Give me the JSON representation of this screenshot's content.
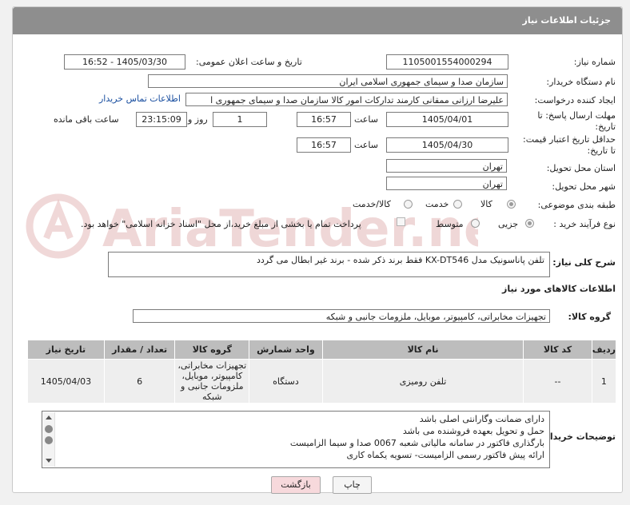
{
  "header": {
    "title": "جزئیات اطلاعات نیاز"
  },
  "fields": {
    "need_number_label": "شماره نیاز:",
    "need_number": "1105001554000294",
    "announce_label": "تاریخ و ساعت اعلان عمومی:",
    "announce_value": "1405/03/30 - 16:52",
    "buyer_label": "نام دستگاه خریدار:",
    "buyer_value": "سازمان صدا و سیمای جمهوری اسلامی ایران",
    "creator_label": "ایجاد کننده درخواست:",
    "creator_value": "علیرضا ارزانی ممقانی کارمند تدارکات امور کالا سازمان صدا و سیمای جمهوری ا",
    "contact_link": "اطلاعات تماس خریدار",
    "reply_label_1": "مهلت ارسال پاسخ: تا",
    "reply_label_2": "تاریخ:",
    "reply_date": "1405/04/01",
    "hour_label": "ساعت",
    "reply_time": "16:57",
    "days_value": "1",
    "days_label": "روز و",
    "remaining_value": "23:15:09",
    "remaining_label": "ساعت باقی مانده",
    "validity_label_1": "حداقل تاریخ اعتبار قیمت:",
    "validity_label_2": "تا تاریخ:",
    "validity_date": "1405/04/30",
    "validity_time": "16:57",
    "province_label": "استان محل تحویل:",
    "province_value": "تهران",
    "city_label": "شهر محل تحویل:",
    "city_value": "تهران",
    "category_label": "طبقه بندی موضوعی:",
    "category_options": [
      "کالا",
      "خدمت",
      "کالا/خدمت"
    ],
    "process_label": "نوع فرآیند خرید :",
    "process_options": [
      "جزیی",
      "متوسط"
    ],
    "treasury_text": "پرداخت تمام یا بخشی از مبلغ خرید،از محل \"اسناد خزانه اسلامی\" خواهد بود."
  },
  "description": {
    "label": "شرح کلی نیاز:",
    "value": "تلفن پاناسونیک مدل KX-DT546     فقط برند ذکر شده - برند غیر ابطال می گردد"
  },
  "goods_section": {
    "title": "اطلاعات کالاهای مورد نیاز",
    "group_label": "گروه کالا:",
    "group_value": "تجهیزات مخابراتی، کامپیوتر، موبایل، ملزومات جانبی و شبکه"
  },
  "table": {
    "headers": [
      "ردیف",
      "کد کالا",
      "نام کالا",
      "واحد شمارش",
      "گروه کالا",
      "تعداد / مقدار",
      "تاریخ نیاز"
    ],
    "rows": [
      [
        "1",
        "--",
        "تلفن رومیزی",
        "دستگاه",
        "تجهیزات مخابراتی، کامپیوتر، موبایل، ملزومات جانبی و شبکه",
        "6",
        "1405/04/03"
      ]
    ]
  },
  "buyer_notes": {
    "label": "توضیحات خریدار:",
    "lines": [
      "دارای ضمانت وگارانتی اصلی باشد",
      "حمل و تحویل بعهده فروشنده می باشد",
      "بارگذاری فاکتور در سامانه مالیاتی شعبه 0067 صدا و سیما الزامیست",
      "ارائه پیش فاکتور رسمی الزامیست- تسویه یکماه کاری"
    ]
  },
  "buttons": {
    "print": "چاپ",
    "back": "بازگشت"
  },
  "watermark": {
    "text": "AriaTender.neT"
  },
  "colors": {
    "header": "#8e8e8e",
    "link": "#1a4fa0",
    "back_button": "#f7d9dc",
    "watermark": "#e3b8b8"
  }
}
